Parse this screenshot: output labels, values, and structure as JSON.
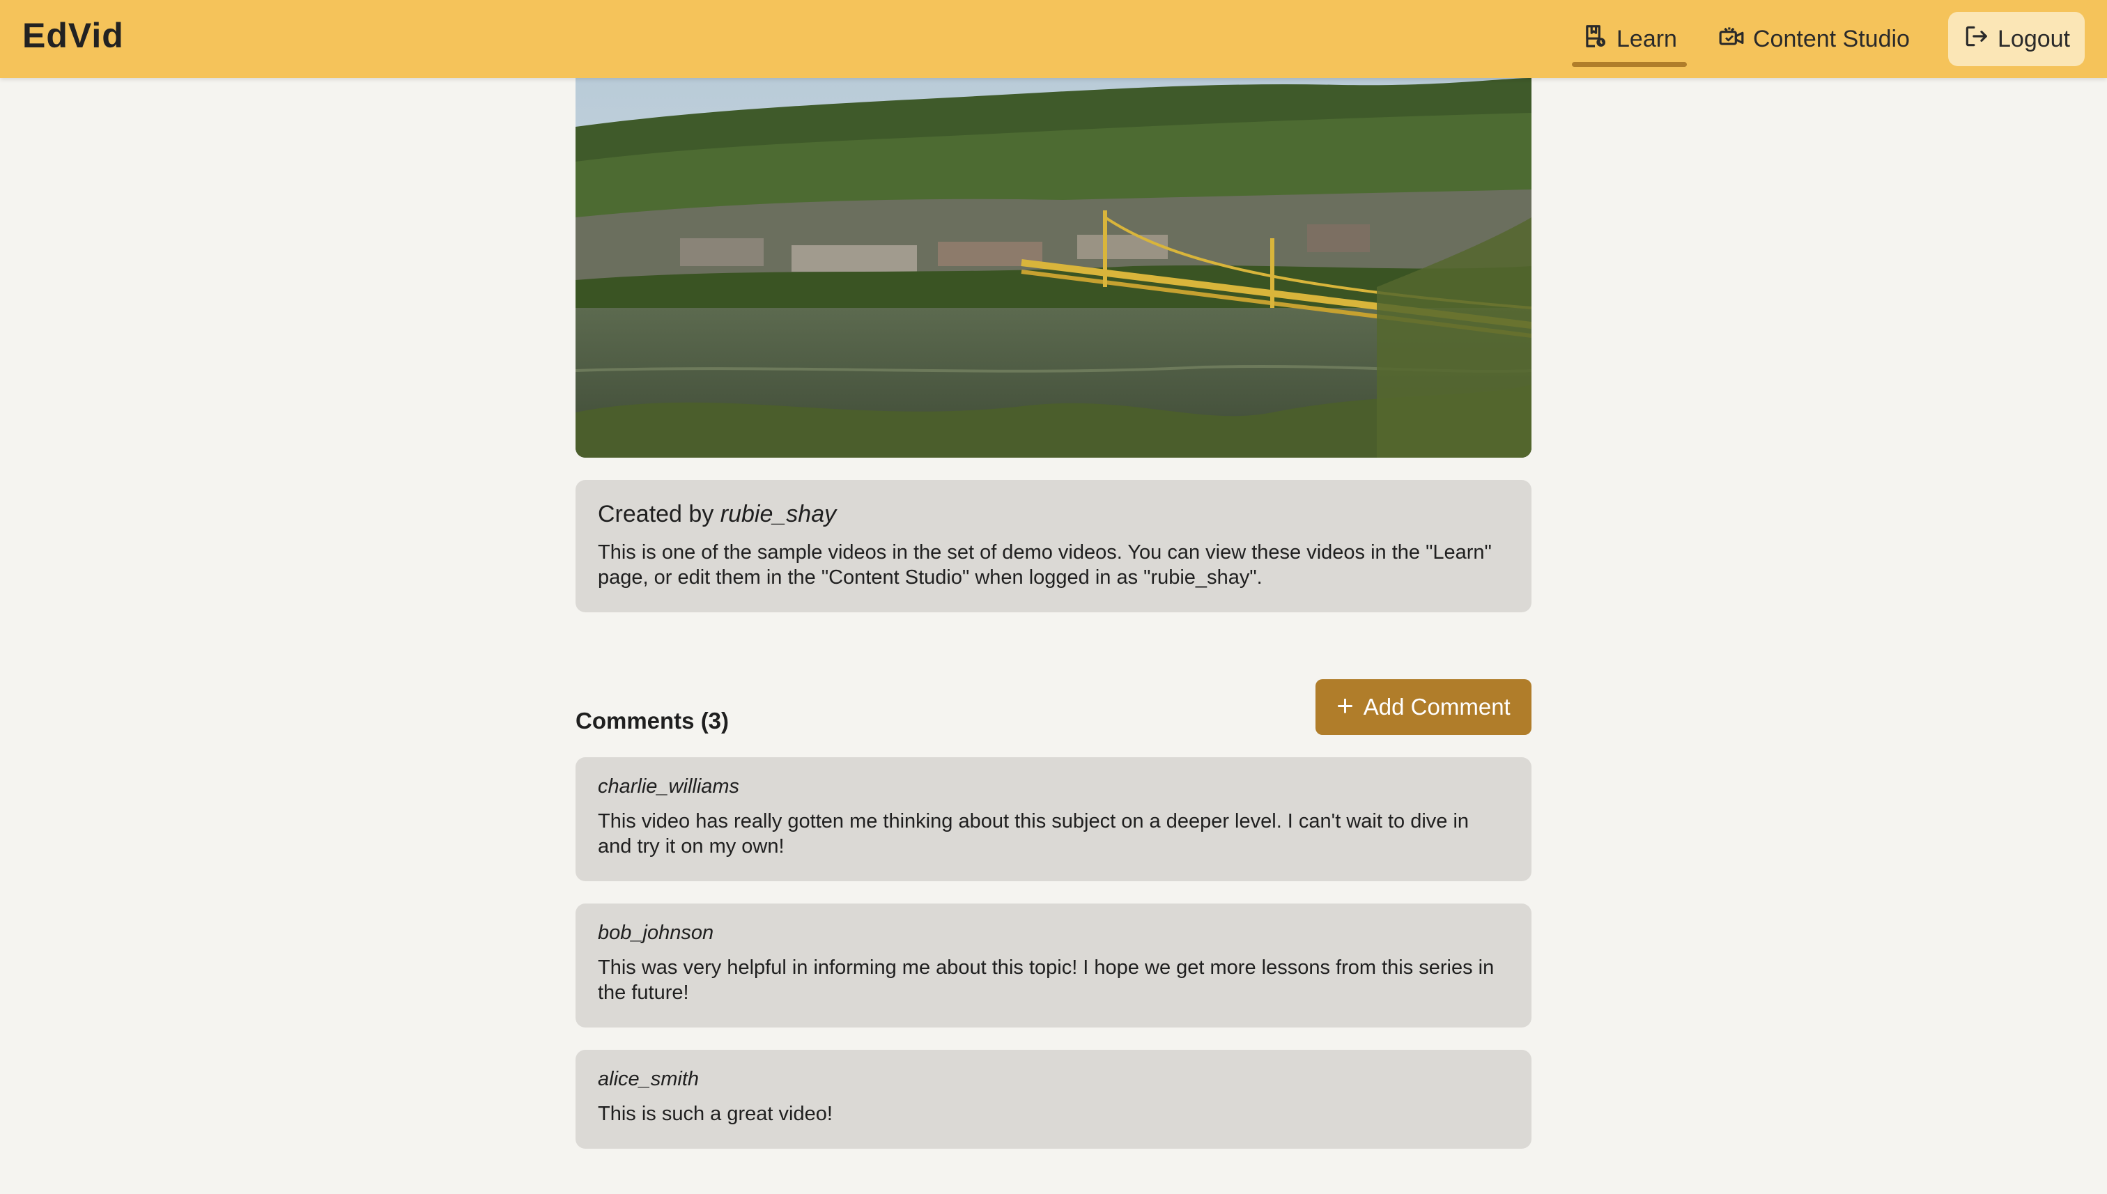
{
  "header": {
    "brand": "EdVid",
    "nav": {
      "learn_label": "Learn",
      "content_studio_label": "Content Studio",
      "logout_label": "Logout"
    },
    "colors": {
      "bar": "#f5c35a",
      "active_underline": "#b07d2a"
    }
  },
  "video": {
    "thumbnail": "river-bridge-landscape"
  },
  "description": {
    "created_prefix": "Created by",
    "author": "rubie_shay",
    "text": "This is one of the sample videos in the set of demo videos. You can view these videos in the \"Learn\" page, or edit them in the \"Content Studio\" when logged in as \"rubie_shay\"."
  },
  "comments": {
    "title": "Comments (3)",
    "add_label": "Add Comment",
    "items": [
      {
        "user": "charlie_williams",
        "text": "This video has really gotten me thinking about this subject on a deeper level. I can't wait to dive in and try it on my own!"
      },
      {
        "user": "bob_johnson",
        "text": "This was very helpful in informing me about this topic! I hope we get more lessons from this series in the future!"
      },
      {
        "user": "alice_smith",
        "text": "This is such a great video!"
      }
    ]
  }
}
